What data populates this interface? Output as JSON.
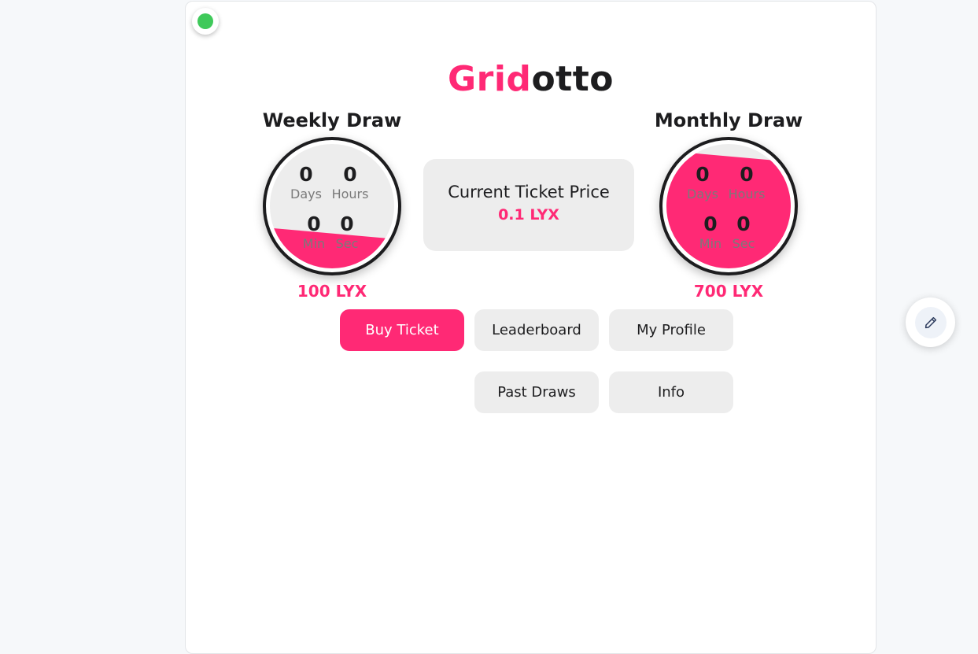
{
  "app": {
    "title_part1": "Grid",
    "title_part2": "otto"
  },
  "colors": {
    "accent": "#ff2975",
    "status_online": "#3fc95a",
    "text_dark": "#1d1d1f",
    "muted": "#7a7a7a"
  },
  "status": {
    "icon": "online-status-dot"
  },
  "weekly": {
    "title": "Weekly Draw",
    "days": "0",
    "hours": "0",
    "min": "0",
    "sec": "0",
    "days_label": "Days",
    "hours_label": "Hours",
    "min_label": "Min",
    "sec_label": "Sec",
    "fill_fraction": 0.3,
    "prize": "100 LYX"
  },
  "monthly": {
    "title": "Monthly Draw",
    "days": "0",
    "hours": "0",
    "min": "0",
    "sec": "0",
    "days_label": "Days",
    "hours_label": "Hours",
    "min_label": "Min",
    "sec_label": "Sec",
    "fill_fraction": 0.92,
    "prize": "700 LYX"
  },
  "ticket": {
    "label": "Current Ticket Price",
    "price": "0.1 LYX"
  },
  "buttons": {
    "buy": "Buy Ticket",
    "leaderboard": "Leaderboard",
    "profile": "My Profile",
    "past": "Past Draws",
    "info": "Info"
  },
  "fab": {
    "icon": "pencil-icon"
  }
}
